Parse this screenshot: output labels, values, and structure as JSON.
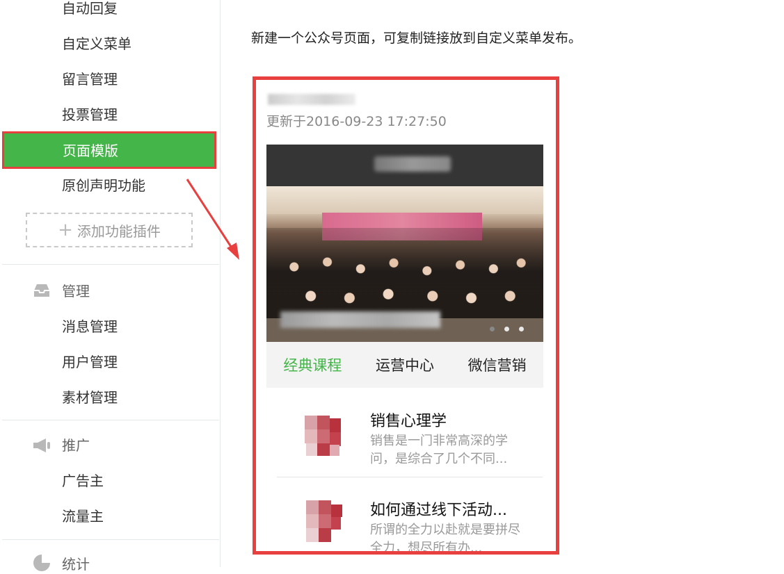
{
  "sidebar": {
    "top_items": [
      "自动回复",
      "自定义菜单",
      "留言管理",
      "投票管理"
    ],
    "active_item": "页面模版",
    "item_after_active": "原创声明功能",
    "add_plugin": "添加功能插件",
    "groups": [
      {
        "title": "管理",
        "icon": "inbox-icon",
        "items": [
          "消息管理",
          "用户管理",
          "素材管理"
        ]
      },
      {
        "title": "推广",
        "icon": "megaphone-icon",
        "items": [
          "广告主",
          "流量主"
        ]
      },
      {
        "title": "统计",
        "icon": "pie-chart-icon",
        "items": []
      }
    ]
  },
  "main": {
    "description": "新建一个公众号页面，可复制链接放到自定义菜单发布。",
    "preview": {
      "updated": "更新于2016-09-23 17:27:50",
      "tabs": [
        "经典课程",
        "运营中心",
        "微信营销"
      ],
      "active_tab": 0,
      "slide_count": 3,
      "active_slide": 0,
      "articles": [
        {
          "title": "销售心理学",
          "summary": "销售是一门非常高深的学问，是综合了几个不同..."
        },
        {
          "title": "如何通过线下活动...",
          "summary": "所谓的全力以赴就是要拼尽全力，想尽所有办..."
        }
      ]
    }
  },
  "colors": {
    "accent": "#44b549",
    "highlight": "#e8403f"
  }
}
